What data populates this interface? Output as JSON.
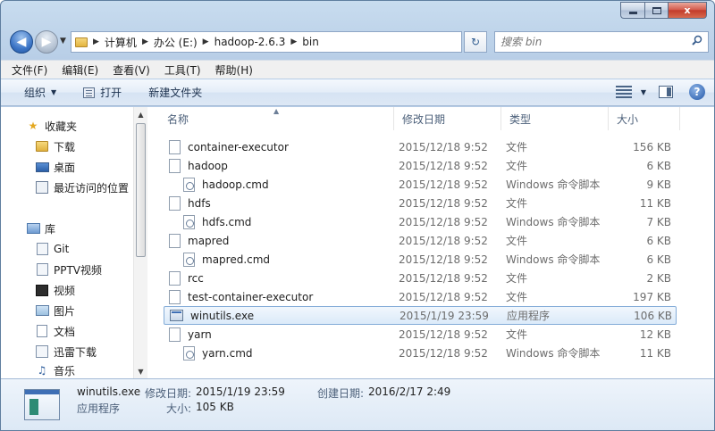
{
  "window": {
    "caption_min": "—",
    "caption_max": "□",
    "caption_close": "x"
  },
  "address": {
    "crumbs": [
      "计算机",
      "办公 (E:)",
      "hadoop-2.6.3",
      "bin"
    ]
  },
  "search": {
    "placeholder": "搜索 bin"
  },
  "menu": [
    "文件(F)",
    "编辑(E)",
    "查看(V)",
    "工具(T)",
    "帮助(H)"
  ],
  "toolbar": {
    "organize": "组织",
    "open": "打开",
    "new_folder": "新建文件夹"
  },
  "nav": {
    "favorites": "收藏夹",
    "downloads": "下载",
    "desktop": "桌面",
    "recent": "最近访问的位置",
    "libraries": "库",
    "git": "Git",
    "pptv": "PPTV视频",
    "video": "视频",
    "pictures": "图片",
    "documents": "文档",
    "thunder": "迅雷下载",
    "music": "音乐"
  },
  "columns": {
    "name": "名称",
    "date": "修改日期",
    "type": "类型",
    "size": "大小"
  },
  "files": [
    {
      "name": "container-executor",
      "date": "2015/12/18 9:52",
      "type": "文件",
      "size": "156 KB",
      "icon": "file"
    },
    {
      "name": "hadoop",
      "date": "2015/12/18 9:52",
      "type": "文件",
      "size": "6 KB",
      "icon": "file"
    },
    {
      "name": "hadoop.cmd",
      "date": "2015/12/18 9:52",
      "type": "Windows 命令脚本",
      "size": "9 KB",
      "icon": "cmd"
    },
    {
      "name": "hdfs",
      "date": "2015/12/18 9:52",
      "type": "文件",
      "size": "11 KB",
      "icon": "file"
    },
    {
      "name": "hdfs.cmd",
      "date": "2015/12/18 9:52",
      "type": "Windows 命令脚本",
      "size": "7 KB",
      "icon": "cmd"
    },
    {
      "name": "mapred",
      "date": "2015/12/18 9:52",
      "type": "文件",
      "size": "6 KB",
      "icon": "file"
    },
    {
      "name": "mapred.cmd",
      "date": "2015/12/18 9:52",
      "type": "Windows 命令脚本",
      "size": "6 KB",
      "icon": "cmd"
    },
    {
      "name": "rcc",
      "date": "2015/12/18 9:52",
      "type": "文件",
      "size": "2 KB",
      "icon": "file"
    },
    {
      "name": "test-container-executor",
      "date": "2015/12/18 9:52",
      "type": "文件",
      "size": "197 KB",
      "icon": "file"
    },
    {
      "name": "winutils.exe",
      "date": "2015/1/19 23:59",
      "type": "应用程序",
      "size": "106 KB",
      "icon": "exe"
    },
    {
      "name": "yarn",
      "date": "2015/12/18 9:52",
      "type": "文件",
      "size": "12 KB",
      "icon": "file"
    },
    {
      "name": "yarn.cmd",
      "date": "2015/12/18 9:52",
      "type": "Windows 命令脚本",
      "size": "11 KB",
      "icon": "cmd"
    }
  ],
  "selected_index": 9,
  "details": {
    "name": "winutils.exe",
    "modified_label": "修改日期:",
    "modified": "2015/1/19 23:59",
    "created_label": "创建日期:",
    "created": "2016/2/17 2:49",
    "type": "应用程序",
    "size_label": "大小:",
    "size": "105 KB"
  }
}
